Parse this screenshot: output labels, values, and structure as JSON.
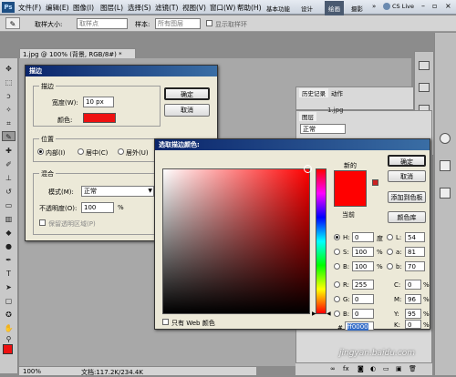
{
  "app": {
    "menu": [
      "文件(F)",
      "编辑(E)",
      "图像(I)",
      "图层(L)",
      "选择(S)",
      "滤镜(T)",
      "视图(V)",
      "窗口(W)",
      "帮助(H)"
    ],
    "workspace_tabs": [
      "基本功能",
      "设计",
      "绘画",
      "摄影"
    ],
    "active_workspace": "绘画",
    "cs_live": "CS Live",
    "options_bar": {
      "sample_size_label": "取样大小:",
      "sample_size_value": "取样点",
      "sample_label": "样本:",
      "sample_value": "所有图层",
      "show_ring_label": "显示取样环"
    },
    "doc_tab": "1.jpg @ 100% (背景, RGB/8#) *",
    "status": {
      "zoom": "100%",
      "doc_info": "文档:117.2K/234.4K"
    },
    "panels": {
      "history_tab": "历史记录",
      "actions_tab": "动作",
      "layers_tab": "图层",
      "blend_mode": "正常",
      "layer_number": "1.jpg"
    }
  },
  "stroke_dialog": {
    "title": "描边",
    "stroke_group": "描边",
    "width_label": "宽度(W):",
    "width_value": "10 px",
    "color_label": "颜色:",
    "color_swatch": "#ee1111",
    "ok": "确定",
    "cancel": "取消",
    "position_group": "位置",
    "position_options": [
      "内部(I)",
      "居中(C)",
      "居外(U)"
    ],
    "position_selected": 0,
    "blend_group": "混合",
    "mode_label": "模式(M):",
    "mode_value": "正常",
    "opacity_label": "不透明度(O):",
    "opacity_value": "100",
    "opacity_unit": "%",
    "preserve_label": "保留透明区域(P)"
  },
  "color_picker": {
    "title": "选取描边颜色:",
    "new_label": "新的",
    "current_label": "当前",
    "new_color": "#ff0000",
    "current_color": "#ff0000",
    "buttons": {
      "ok": "确定",
      "cancel": "取消",
      "add_swatch": "添加到色板",
      "libraries": "颜色库"
    },
    "web_only_label": "只有 Web 颜色",
    "hsb": [
      {
        "label": "H:",
        "value": "0",
        "unit": "度"
      },
      {
        "label": "S:",
        "value": "100",
        "unit": "%"
      },
      {
        "label": "B:",
        "value": "100",
        "unit": "%"
      }
    ],
    "rgb": [
      {
        "label": "R:",
        "value": "255"
      },
      {
        "label": "G:",
        "value": "0"
      },
      {
        "label": "B:",
        "value": "0"
      }
    ],
    "lab": [
      {
        "label": "L:",
        "value": "54"
      },
      {
        "label": "a:",
        "value": "81"
      },
      {
        "label": "b:",
        "value": "70"
      }
    ],
    "cmyk": [
      {
        "label": "C:",
        "value": "0",
        "unit": "%"
      },
      {
        "label": "M:",
        "value": "96",
        "unit": "%"
      },
      {
        "label": "Y:",
        "value": "95",
        "unit": "%"
      },
      {
        "label": "K:",
        "value": "0",
        "unit": "%"
      }
    ],
    "hex_label": "#",
    "hex_value": "ff0000"
  },
  "watermark": "jingyan.baidu.com"
}
